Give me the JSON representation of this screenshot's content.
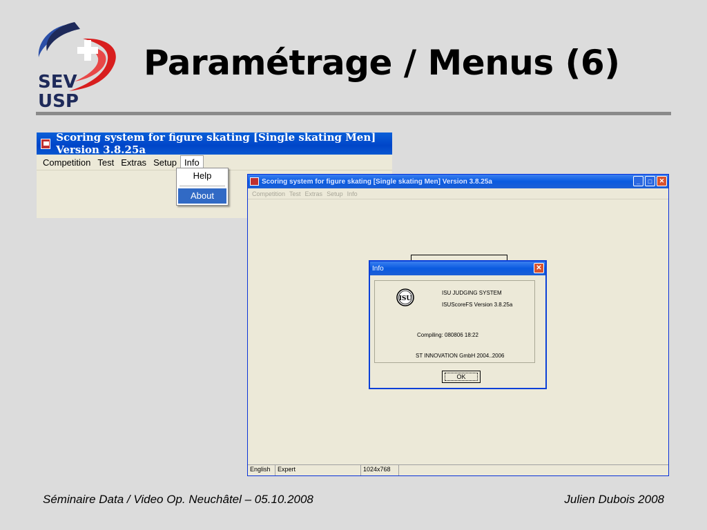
{
  "slide": {
    "title": "Paramétrage / Menus (6)",
    "logo_line1": "SEV",
    "logo_line2": "USP",
    "footer_left": "Séminaire Data / Video Op. Neuchâtel – 05.10.2008",
    "footer_right": "Julien Dubois 2008"
  },
  "small_window": {
    "title": "Scoring system for figure skating [Single skating Men]  Version 3.8.25a",
    "menu": [
      "Competition",
      "Test",
      "Extras",
      "Setup",
      "Info"
    ],
    "open_menu": "Info",
    "dropdown": {
      "help": "Help",
      "about": "About"
    }
  },
  "main_window": {
    "title": "Scoring system for figure skating [Single skating Men]  Version 3.8.25a",
    "menu": [
      "Competition",
      "Test",
      "Extras",
      "Setup",
      "Info"
    ],
    "status": {
      "language": "English",
      "mode": "Expert",
      "resolution": "1024x768"
    }
  },
  "dialog": {
    "title": "Info",
    "line1": "ISU JUDGING SYSTEM",
    "line2": "ISUScoreFS Version 3.8.25a",
    "compiling": "Compiling: 080806 18:22",
    "company": "ST INNOVATION  GmbH 2004..2006",
    "ok_label": "OK"
  },
  "colors": {
    "xp_titlebar": "#0a5ae0",
    "xp_face": "#ece9d8",
    "menu_highlight": "#316ac5",
    "logo_red": "#d81e1e",
    "logo_navy": "#1e2a5a"
  }
}
